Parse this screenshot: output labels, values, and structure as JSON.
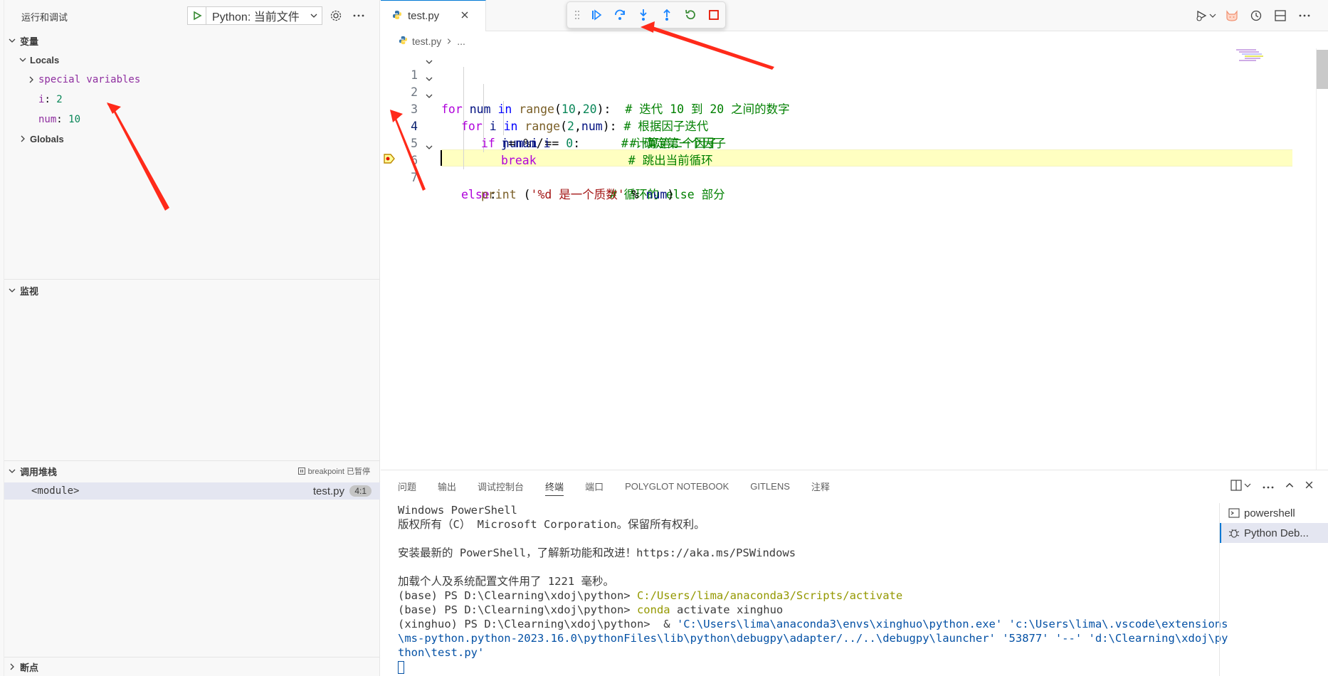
{
  "sidebar": {
    "title": "运行和调试",
    "config_label": "Python: 当前文件",
    "variables_header": "变量",
    "locals_label": "Locals",
    "special_variables": "special variables",
    "vars": [
      {
        "name": "i",
        "value": "2"
      },
      {
        "name": "num",
        "value": "10"
      }
    ],
    "globals_label": "Globals",
    "watch_header": "监视",
    "callstack_header": "调用堆栈",
    "callstack_status": "breakpoint 已暂停",
    "frame_name": "<module>",
    "frame_file": "test.py",
    "frame_pos": "4:1",
    "breakpoints_header": "断点"
  },
  "editor": {
    "tab_name": "test.py",
    "breadcrumb_file": "test.py",
    "breadcrumb_more": "...",
    "lines": [
      {
        "n": "1"
      },
      {
        "n": "2"
      },
      {
        "n": "3"
      },
      {
        "n": "4"
      },
      {
        "n": "5"
      },
      {
        "n": "6"
      },
      {
        "n": "7"
      }
    ],
    "code": {
      "l1": {
        "kw": "for",
        "a": " num ",
        "kw2": "in",
        "fn": " range",
        "p1": "(",
        "n1": "10",
        "c": ",",
        "n2": "20",
        "p2": "):",
        "cm": "  # 迭代 10 到 20 之间的数字"
      },
      "l2": {
        "kw": "for",
        "a": " i ",
        "kw2": "in",
        "fn": " range",
        "p1": "(",
        "n1": "2",
        "c": ",",
        "v": "num",
        "p2": "):",
        "cm": " # 根据因子迭代"
      },
      "l3": {
        "kw": "if",
        "v1": " num",
        "op": "%",
        "v2": "i",
        "eq": " == ",
        "n": "0",
        "col": ":",
        "cm": "       # 确定第一个因子"
      },
      "l4": {
        "v1": "j",
        "op": "=",
        "v2": "num",
        "sl": "/",
        "v3": "i",
        "cm": "          # 计算第二个因子"
      },
      "l5": {
        "kw": "break",
        "cm": "             # 跳出当前循环"
      },
      "l6": {
        "kw": "else",
        "col": ":",
        "cm": "                # 循环的 else 部分"
      },
      "l7": {
        "fn": "print",
        "p1": " (",
        "str": "'%d 是一个质数'",
        "op": " % ",
        "v": "num",
        "p2": ")"
      }
    }
  },
  "panel": {
    "tabs": [
      "问题",
      "输出",
      "调试控制台",
      "终端",
      "端口",
      "POLYGLOT NOTEBOOK",
      "GITLENS",
      "注释"
    ],
    "active_tab": "终端",
    "terminal": {
      "l1": "Windows PowerShell",
      "l2": "版权所有（C） Microsoft Corporation。保留所有权利。",
      "l3": "",
      "l4": "安装最新的 PowerShell，了解新功能和改进！https://aka.ms/PSWindows",
      "l5": "",
      "l6": "加载个人及系统配置文件用了 1221 毫秒。",
      "l7a": "(base) PS D:\\Clearning\\xdoj\\python> ",
      "l7b": "C:/Users/lima/anaconda3/Scripts/activate",
      "l8a": "(base) PS D:\\Clearning\\xdoj\\python> ",
      "l8b": "conda",
      "l8c": " activate xinghuo",
      "l9a": "(xinghuo) PS D:\\Clearning\\xdoj\\python>  & ",
      "l9b": "'C:\\Users\\lima\\anaconda3\\envs\\xinghuo\\python.exe' 'c:\\Users\\lima\\.vscode\\extensions",
      "l10": "\\ms-python.python-2023.16.0\\pythonFiles\\lib\\python\\debugpy\\adapter/../..\\debugpy\\launcher' '53877' '--' 'd:\\Clearning\\xdoj\\py",
      "l11": "thon\\test.py'"
    },
    "term_list": [
      "powershell",
      "Python Deb..."
    ]
  },
  "colors": {
    "accent": "#0078d4",
    "current_line": "#ffff99",
    "arrow": "#ff2a1a"
  }
}
